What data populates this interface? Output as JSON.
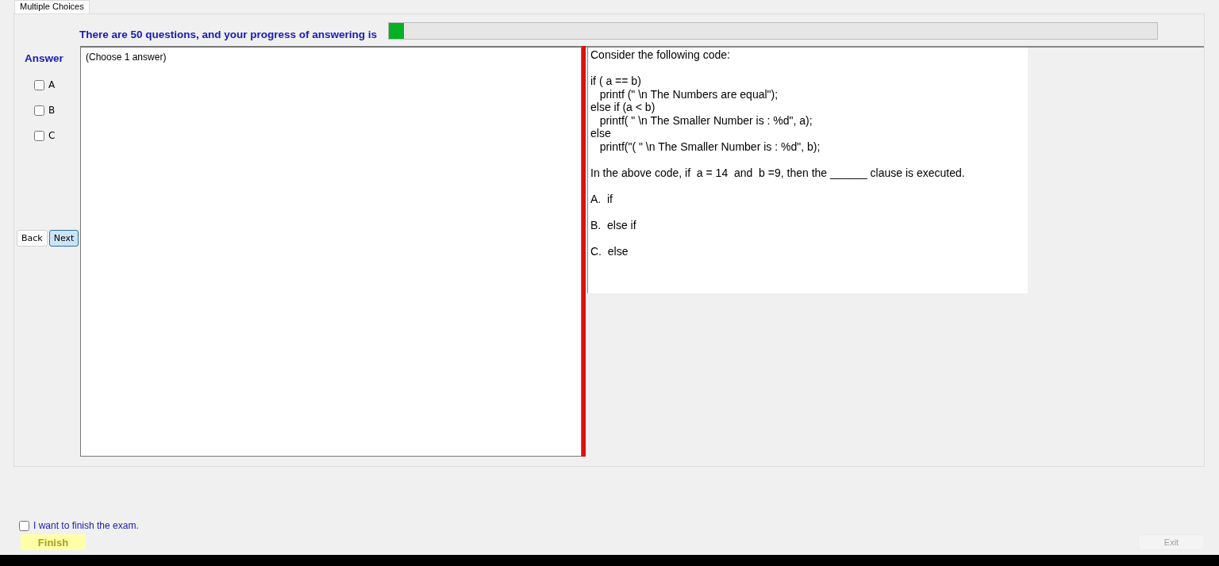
{
  "tabs": [
    {
      "label": "Multiple Choices",
      "selected": true
    }
  ],
  "progress": {
    "label": "There are 50 questions, and your progress of answering is",
    "level": 0.02
  },
  "answer": {
    "title": "Answer",
    "options": [
      {
        "label": "A",
        "checked": false
      },
      {
        "label": "B",
        "checked": false
      },
      {
        "label": "C",
        "checked": false
      }
    ],
    "hint": "(Choose 1 answer)"
  },
  "nav_buttons": [
    {
      "label": "Back",
      "focused": false
    },
    {
      "label": "Next",
      "focused": true
    }
  ],
  "question": {
    "paragraphs": [
      {
        "kind": "text",
        "text": "Consider the following code:"
      },
      {
        "kind": "code",
        "text": "if ( a == b)\n   printf (\" \\n The Numbers are equal\");\nelse if (a < b)\n   printf( \" \\n The Smaller Number is : %d\", a);\nelse\n   printf(\"( \" \\n The Smaller Number is : %d\", b);"
      },
      {
        "kind": "text",
        "text": "In the above code, if  a = 14  and  b =9, then the ______ clause is executed."
      },
      {
        "kind": "option",
        "text": "A.  if"
      },
      {
        "kind": "option",
        "text": "B.  else if"
      },
      {
        "kind": "option",
        "text": "C.  else"
      }
    ]
  },
  "finish": {
    "confirm_label": "I want to finish the exam.",
    "checked": false,
    "button": "Finish"
  },
  "exit": {
    "label": "Exit",
    "disabled": true
  }
}
